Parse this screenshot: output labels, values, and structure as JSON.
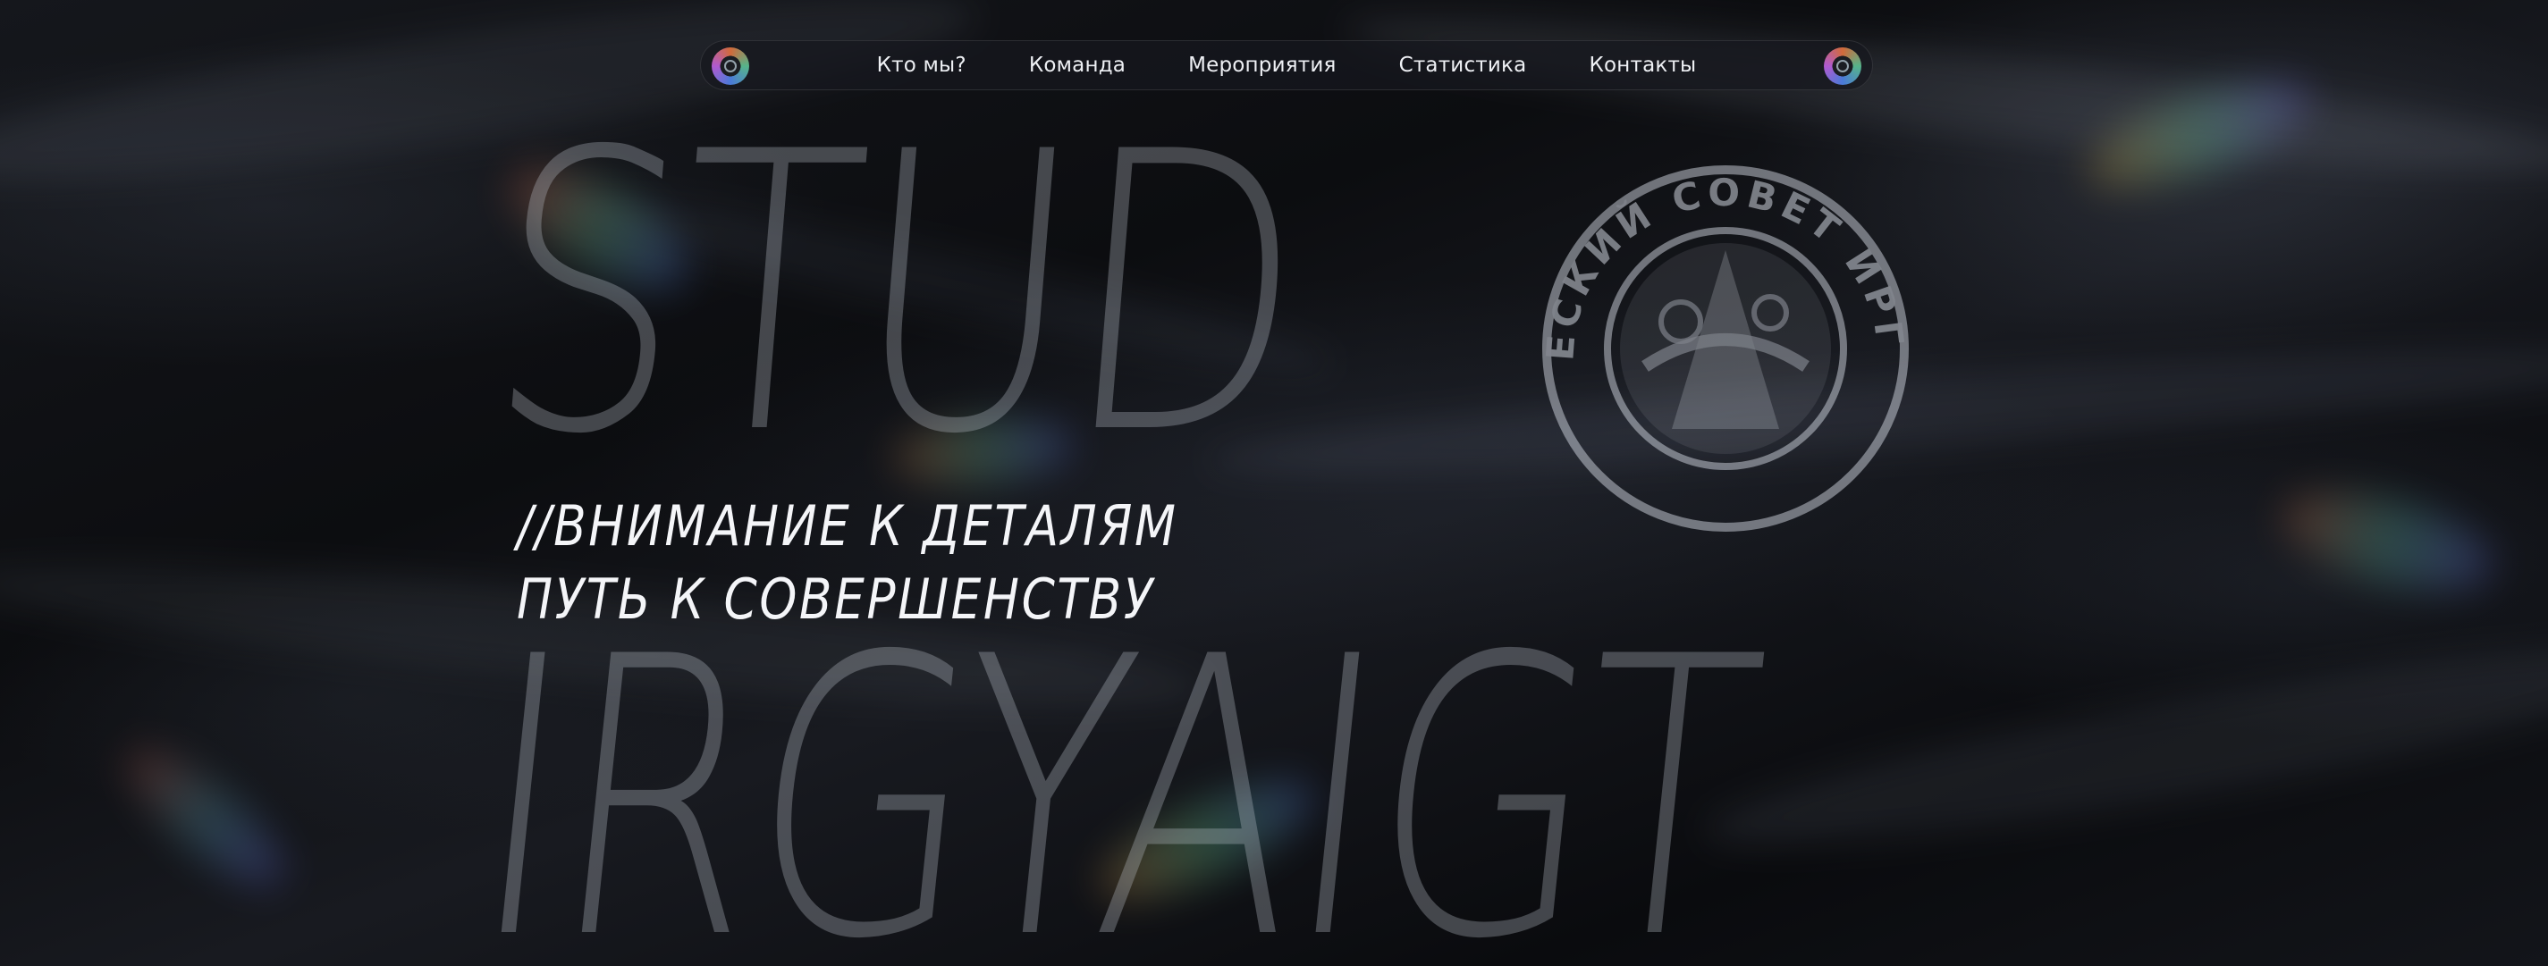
{
  "nav": {
    "items": [
      {
        "label": "Кто мы?"
      },
      {
        "label": "Команда"
      },
      {
        "label": "Мероприятия"
      },
      {
        "label": "Статистика"
      },
      {
        "label": "Контакты"
      }
    ]
  },
  "hero": {
    "watermark_top": "STUD",
    "watermark_bottom": "IRGYAIGT",
    "tagline_line1": "//ВНИМАНИЕ К ДЕТАЛЯМ",
    "tagline_line2": "ПУТЬ К СОВЕРШЕНСТВУ",
    "seal_text": "СТУДЕНЧЕСКИЙ СОВЕТ ИРГЯИГТ ПГУ"
  },
  "colors": {
    "background": "#0d0e11",
    "text": "#f4f5f8",
    "watermark": "#c8cdd7"
  },
  "icons": {
    "nav_logo_left": "logo-badge-icon",
    "nav_logo_right": "logo-badge-icon",
    "seal": "student-council-seal-icon"
  }
}
